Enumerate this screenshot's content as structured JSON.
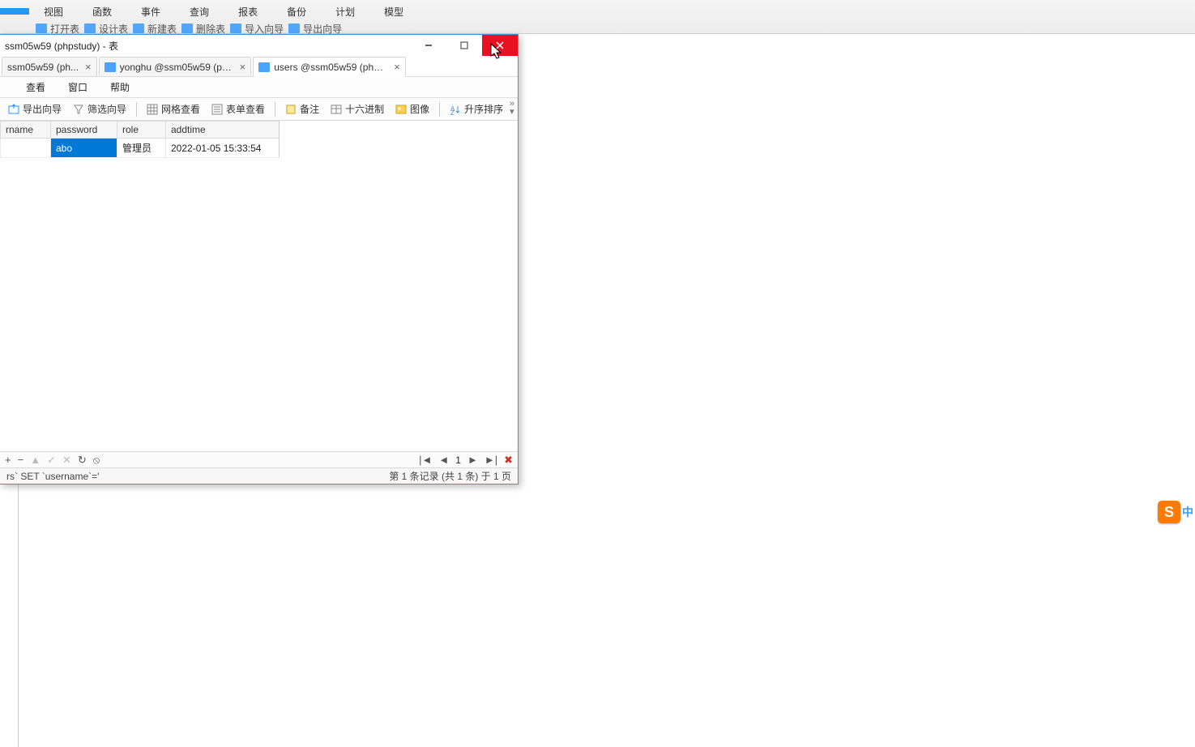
{
  "bg_menus": {
    "items": [
      {
        "label": "",
        "active": true
      },
      {
        "label": "视图"
      },
      {
        "label": "函数"
      },
      {
        "label": "事件"
      },
      {
        "label": "查询"
      },
      {
        "label": "报表"
      },
      {
        "label": "备份"
      },
      {
        "label": "计划"
      },
      {
        "label": "模型"
      }
    ]
  },
  "bg_toolbar": {
    "items": [
      "打开表",
      "设计表",
      "新建表",
      "删除表",
      "导入向导",
      "导出向导"
    ]
  },
  "child": {
    "title": "ssm05w59 (phpstudy) - 表",
    "tabs": [
      {
        "label": "ssm05w59 (ph..."
      },
      {
        "label": "yonghu @ssm05w59 (ph..."
      },
      {
        "label": "users @ssm05w59 (phps...",
        "active": true
      }
    ],
    "submenu": {
      "items": [
        "",
        "查看",
        "窗口",
        "帮助"
      ],
      "first_partial": ""
    },
    "toolbar": {
      "export": "导出向导",
      "filter": "筛选向导",
      "gridview": "网格查看",
      "formview": "表单查看",
      "memo": "备注",
      "hex": "十六进制",
      "image": "图像",
      "sort": "升序排序"
    },
    "grid": {
      "headers": [
        "rname",
        "password",
        "role",
        "addtime"
      ],
      "row": {
        "rname": "",
        "password": "abo",
        "role": "管理员",
        "addtime": "2022-01-05 15:33:54"
      }
    },
    "nav": {
      "page": "1"
    },
    "status": {
      "sql_fragment": "rs` SET `username`='",
      "record": "第 1 条记录 (共 1 条) 于 1 页"
    }
  },
  "ime": {
    "char": "S",
    "lang": "中"
  }
}
